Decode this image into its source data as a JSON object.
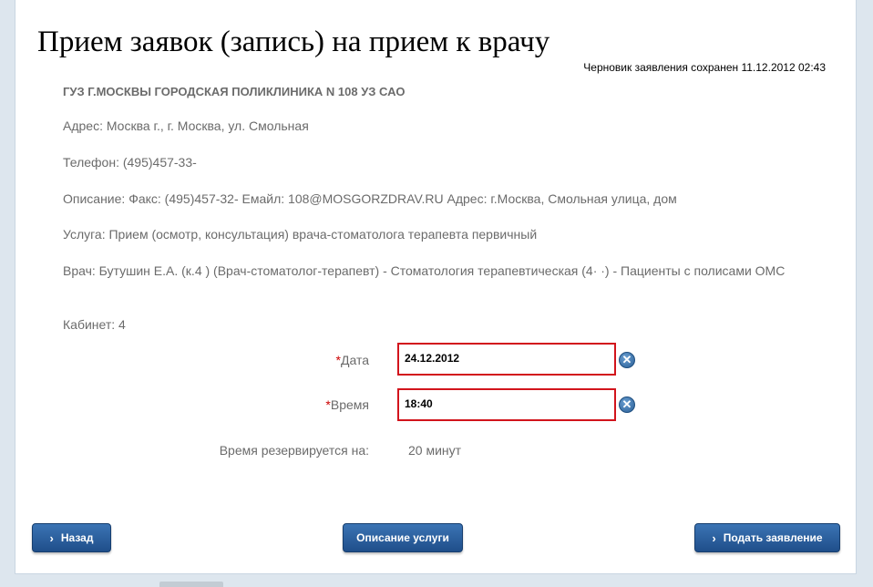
{
  "page": {
    "title": "Прием заявок (запись) на прием к врачу",
    "draft_note": "Черновик заявления сохранен 11.12.2012 02:43"
  },
  "info": {
    "org_name": "ГУЗ Г.МОСКВЫ ГОРОДСКАЯ ПОЛИКЛИНИКА N 108 УЗ САО",
    "address": "Адрес: Москва г., г. Москва, ул. Смольная",
    "phone": "Телефон: (495)457-33-",
    "description": "Описание: Факс: (495)457-32-      Емайл:       108@MOSGORZDRAV.RU Адрес: г.Москва, Смольная улица, дом",
    "service": "Услуга: Прием (осмотр, консультация) врача-стоматолога терапевта первичный",
    "doctor": "Врач: Бутушин   Е.А. (к.4     ) (Врач-стоматолог-терапевт) - Стоматология терапевтическая (4·   ·) - Пациенты с полисами ОМС",
    "cabinet": "Кабинет: 4"
  },
  "form": {
    "required_mark": "*",
    "date_label": "Дата",
    "date_value": "24.12.2012",
    "time_label": "Время",
    "time_value": "18:40",
    "clear_symbol": "✕",
    "reserve_label": "Время резервируется на:",
    "reserve_value": "20 минут"
  },
  "buttons": {
    "chevron": "›",
    "back": "Назад",
    "service_description": "Описание услуги",
    "submit": "Подать заявление"
  }
}
